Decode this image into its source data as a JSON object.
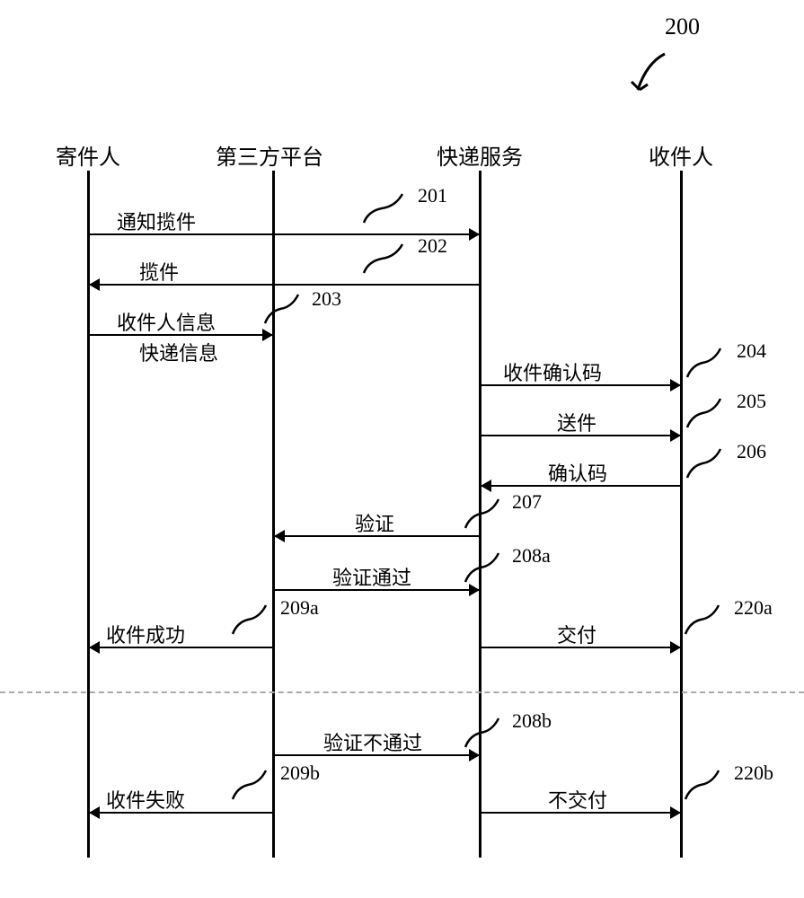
{
  "figure": {
    "number": "200"
  },
  "participants": [
    "寄件人",
    "第三方平台",
    "快递服务",
    "收件人"
  ],
  "messages": [
    {
      "ref": "201",
      "from": "寄件人",
      "to": "快递服务",
      "label": "通知揽件"
    },
    {
      "ref": "202",
      "from": "快递服务",
      "to": "寄件人",
      "label": "揽件"
    },
    {
      "ref": "203",
      "from": "寄件人",
      "to": "第三方平台",
      "label": "收件人信息",
      "label2": "快递信息"
    },
    {
      "ref": "204",
      "from": "第三方平台",
      "to": "收件人",
      "label": "收件确认码"
    },
    {
      "ref": "205",
      "from": "快递服务",
      "to": "收件人",
      "label": "送件"
    },
    {
      "ref": "206",
      "from": "收件人",
      "to": "快递服务",
      "label": "确认码"
    },
    {
      "ref": "207",
      "from": "快递服务",
      "to": "第三方平台",
      "label": "验证"
    },
    {
      "ref": "208a",
      "from": "第三方平台",
      "to": "快递服务",
      "label": "验证通过"
    },
    {
      "ref": "209a",
      "from": "第三方平台",
      "to": "寄件人",
      "label": "收件成功"
    },
    {
      "ref": "220a",
      "from": "快递服务",
      "to": "收件人",
      "label": "交付"
    },
    {
      "ref": "208b",
      "from": "第三方平台",
      "to": "快递服务",
      "label": "验证不通过"
    },
    {
      "ref": "209b",
      "from": "第三方平台",
      "to": "寄件人",
      "label": "收件失败"
    },
    {
      "ref": "220b",
      "from": "快递服务",
      "to": "收件人",
      "label": "不交付"
    }
  ]
}
